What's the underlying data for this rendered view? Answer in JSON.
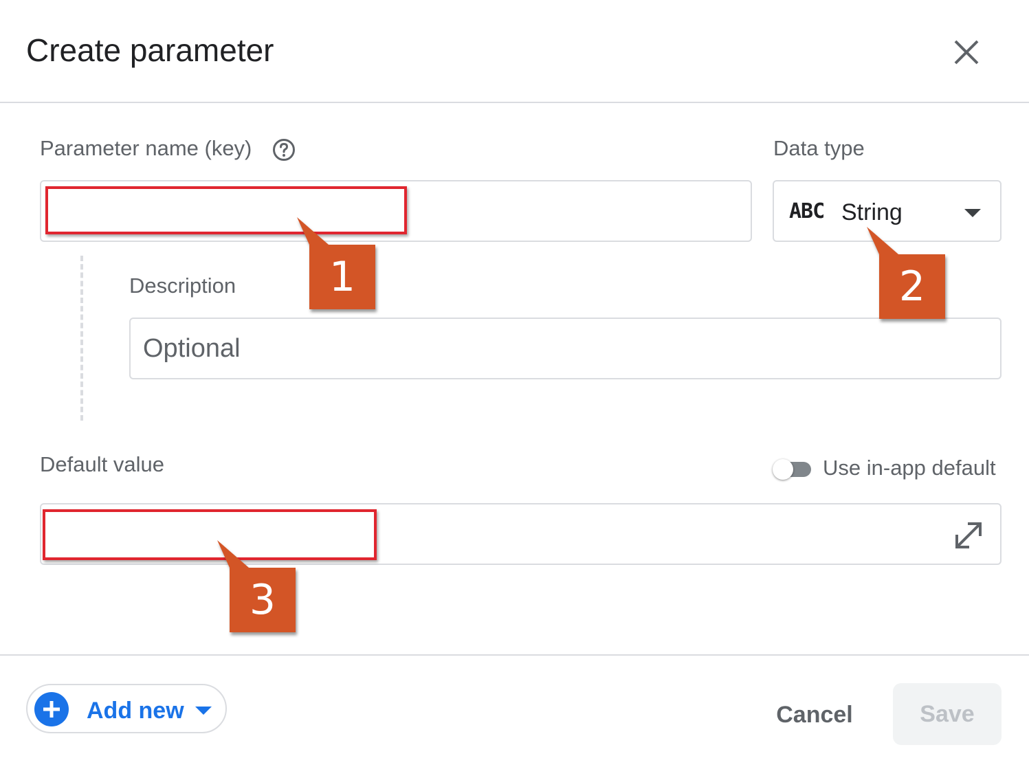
{
  "dialog": {
    "title": "Create parameter"
  },
  "form": {
    "param_name_label": "Parameter name (key)",
    "param_name_value": "",
    "data_type_label": "Data type",
    "data_type_value": "String",
    "data_type_icon_text": "ABC",
    "description_label": "Description",
    "description_placeholder": "Optional",
    "default_value_label": "Default value",
    "default_value_value": "",
    "use_in_app_default_label": "Use in-app default",
    "use_in_app_default_on": false
  },
  "footer": {
    "add_new_label": "Add new",
    "cancel_label": "Cancel",
    "save_label": "Save"
  },
  "annotations": {
    "callouts": [
      "1",
      "2",
      "3"
    ],
    "callout_color": "#d35425",
    "highlight_color": "#e0262f"
  },
  "colors": {
    "accent": "#1a73e8",
    "border": "#dadce0",
    "label": "#5f6368"
  },
  "icons": {
    "close": "close-icon",
    "help": "help-circle-icon",
    "data_type": "abc-icon",
    "dropdown": "chevron-down-icon",
    "expand": "expand-icon",
    "add": "plus-icon"
  }
}
